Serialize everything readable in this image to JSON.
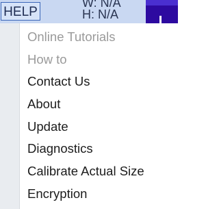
{
  "menubar": {
    "help_label": "HELP",
    "width_label": "W: N/A",
    "height_label": "H: N/A"
  },
  "dropdown": {
    "items": [
      {
        "label": "Online Tutorials",
        "enabled": false
      },
      {
        "label": "How to",
        "enabled": false
      },
      {
        "label": "Contact Us",
        "enabled": true
      },
      {
        "label": "About",
        "enabled": true
      },
      {
        "label": "Update",
        "enabled": true
      },
      {
        "label": "Diagnostics",
        "enabled": true
      },
      {
        "label": "Calibrate Actual Size",
        "enabled": true
      },
      {
        "label": "Encryption",
        "enabled": true
      }
    ]
  },
  "colors": {
    "menubar_bg": "#c9d8f2",
    "swatch": "#2d0aa0",
    "disabled_text": "#9a9a9a"
  }
}
